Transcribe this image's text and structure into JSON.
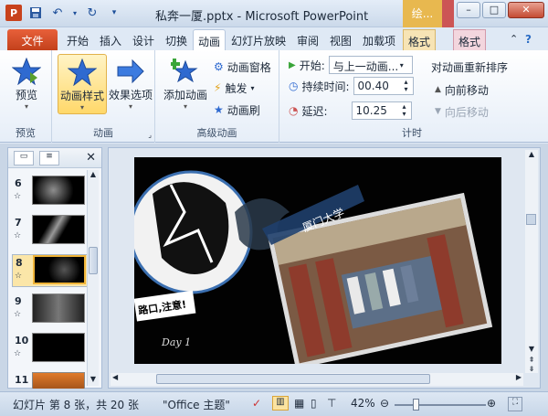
{
  "window": {
    "title": "私奔一厦.pptx - Microsoft PowerPoint",
    "context_tab": "绘...",
    "minimize": "–",
    "maximize": "□",
    "close": "✕"
  },
  "tabs": [
    {
      "label": "文件"
    },
    {
      "label": "开始"
    },
    {
      "label": "插入"
    },
    {
      "label": "设计"
    },
    {
      "label": "切换"
    },
    {
      "label": "动画"
    },
    {
      "label": "幻灯片放映"
    },
    {
      "label": "审阅"
    },
    {
      "label": "视图"
    },
    {
      "label": "加载项"
    },
    {
      "label": "格式"
    },
    {
      "label": "格式"
    }
  ],
  "ribbon": {
    "preview": {
      "button": "预览",
      "group": "预览"
    },
    "animation": {
      "style_button": "动画样式",
      "effect_button": "效果选项",
      "group": "动画"
    },
    "advanced": {
      "add_button": "添加动画",
      "pane": "动画窗格",
      "trigger": "触发",
      "painter": "动画刷",
      "group": "高级动画"
    },
    "timing": {
      "start_label": "开始:",
      "start_value": "与上一动画...",
      "duration_label": "持续时间:",
      "duration_value": "00.40",
      "delay_label": "延迟:",
      "delay_value": "10.25",
      "reorder_title": "对动画重新排序",
      "move_earlier": "向前移动",
      "move_later": "向后移动",
      "group": "计时"
    }
  },
  "slides": [
    {
      "num": "6",
      "star": "☆"
    },
    {
      "num": "7",
      "star": "☆"
    },
    {
      "num": "8",
      "star": "☆"
    },
    {
      "num": "9",
      "star": "☆"
    },
    {
      "num": "10",
      "star": "☆"
    },
    {
      "num": "11",
      "star": ""
    }
  ],
  "slide_content": {
    "banner_text": "厦门大学",
    "sign_text": "路口,注意!",
    "script_text": "Day 1"
  },
  "status": {
    "slide_info": "幻灯片 第 8 张，共 20 张",
    "theme": "\"Office 主题\"",
    "zoom": "42%"
  }
}
